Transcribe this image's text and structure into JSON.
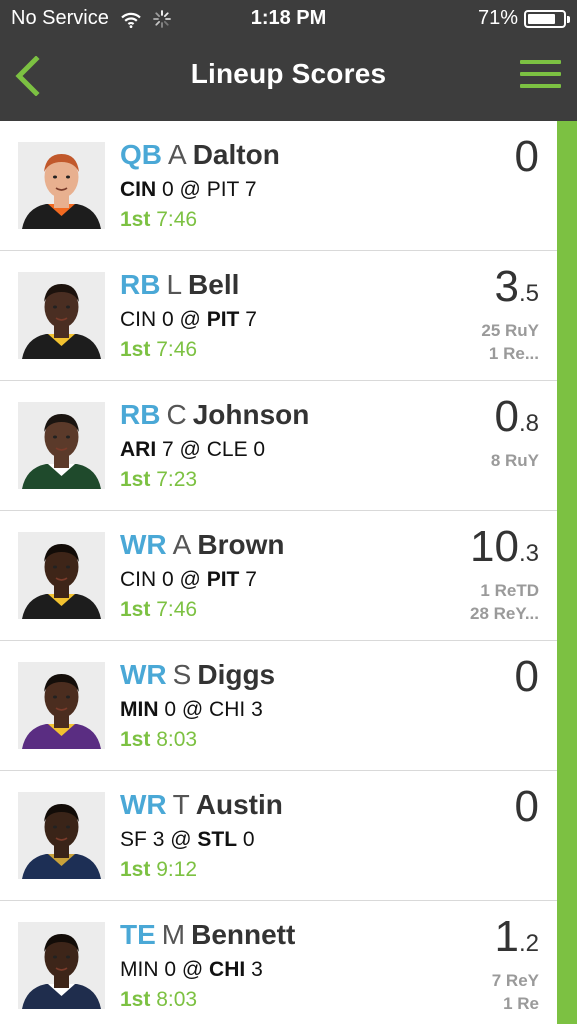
{
  "status_bar": {
    "carrier": "No Service",
    "time": "1:18 PM",
    "battery": "71%"
  },
  "nav": {
    "title": "Lineup Scores",
    "back_icon": "chevron-left-icon",
    "menu_icon": "hamburger-menu-icon"
  },
  "colors": {
    "header_bg": "#3d3d3d",
    "accent_green": "#7cc142",
    "position_blue": "#4aa8d6"
  },
  "players": [
    {
      "pos": "QB",
      "initial": "A",
      "last": "Dalton",
      "away": "CIN",
      "away_score": "0",
      "home": "PIT",
      "home_score": "7",
      "bold": "away",
      "quarter": "1st",
      "clock": "7:46",
      "score_int": "0",
      "score_dec": "",
      "stats": []
    },
    {
      "pos": "RB",
      "initial": "L",
      "last": "Bell",
      "away": "CIN",
      "away_score": "0",
      "home": "PIT",
      "home_score": "7",
      "bold": "home",
      "quarter": "1st",
      "clock": "7:46",
      "score_int": "3",
      "score_dec": ".5",
      "stats": [
        "25 RuY",
        "1 Re..."
      ]
    },
    {
      "pos": "RB",
      "initial": "C",
      "last": "Johnson",
      "away": "ARI",
      "away_score": "7",
      "home": "CLE",
      "home_score": "0",
      "bold": "away",
      "quarter": "1st",
      "clock": "7:23",
      "score_int": "0",
      "score_dec": ".8",
      "stats": [
        "8 RuY"
      ]
    },
    {
      "pos": "WR",
      "initial": "A",
      "last": "Brown",
      "away": "CIN",
      "away_score": "0",
      "home": "PIT",
      "home_score": "7",
      "bold": "home",
      "quarter": "1st",
      "clock": "7:46",
      "score_int": "10",
      "score_dec": ".3",
      "stats": [
        "1 ReTD",
        "28 ReY..."
      ]
    },
    {
      "pos": "WR",
      "initial": "S",
      "last": "Diggs",
      "away": "MIN",
      "away_score": "0",
      "home": "CHI",
      "home_score": "3",
      "bold": "away",
      "quarter": "1st",
      "clock": "8:03",
      "score_int": "0",
      "score_dec": "",
      "stats": []
    },
    {
      "pos": "WR",
      "initial": "T",
      "last": "Austin",
      "away": "SF",
      "away_score": "3",
      "home": "STL",
      "home_score": "0",
      "bold": "home",
      "quarter": "1st",
      "clock": "9:12",
      "score_int": "0",
      "score_dec": "",
      "stats": []
    },
    {
      "pos": "TE",
      "initial": "M",
      "last": "Bennett",
      "away": "MIN",
      "away_score": "0",
      "home": "CHI",
      "home_score": "3",
      "bold": "home",
      "quarter": "1st",
      "clock": "8:03",
      "score_int": "1",
      "score_dec": ".2",
      "stats": [
        "7 ReY",
        "1 Re"
      ]
    }
  ]
}
